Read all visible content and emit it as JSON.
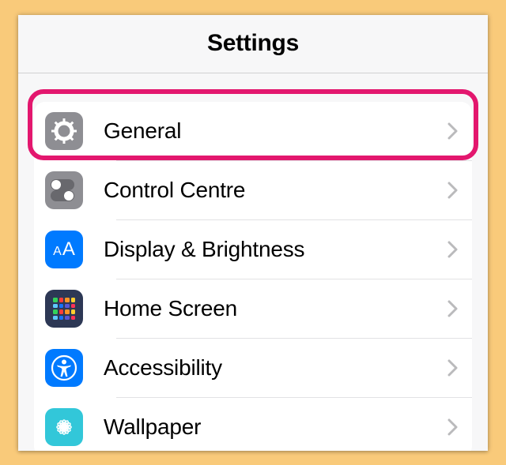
{
  "header": {
    "title": "Settings"
  },
  "rows": [
    {
      "id": "general",
      "label": "General",
      "highlighted": true
    },
    {
      "id": "control-centre",
      "label": "Control Centre"
    },
    {
      "id": "display-brightness",
      "label": "Display & Brightness"
    },
    {
      "id": "home-screen",
      "label": "Home Screen"
    },
    {
      "id": "accessibility",
      "label": "Accessibility"
    },
    {
      "id": "wallpaper",
      "label": "Wallpaper"
    }
  ],
  "icons": {
    "general": "gear-icon",
    "control-centre": "toggles-icon",
    "display-brightness": "aa-icon",
    "home-screen": "app-grid-icon",
    "accessibility": "accessibility-body-icon",
    "wallpaper": "flower-icon"
  },
  "home_grid_colors": [
    "#33d15b",
    "#fc3d39",
    "#fd9426",
    "#ffcf2f",
    "#5ec8fa",
    "#1572ff",
    "#5856d6",
    "#fc3158",
    "#33d15b",
    "#fc3d39",
    "#fd9426",
    "#ffcf2f",
    "#5ec8fa",
    "#1572ff",
    "#5856d6",
    "#fc3158"
  ],
  "colors": {
    "highlight": "#e3176e"
  }
}
